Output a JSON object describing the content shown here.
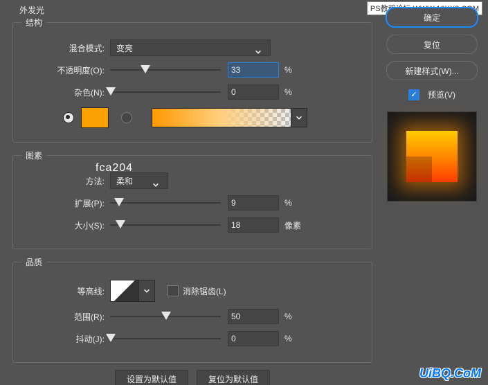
{
  "title": "外发光",
  "structure": {
    "legend": "结构",
    "blend_label": "混合模式:",
    "blend_value": "变亮",
    "opacity_label": "不透明度(O):",
    "opacity_value": "33",
    "opacity_unit": "%",
    "noise_label": "杂色(N):",
    "noise_value": "0",
    "noise_unit": "%",
    "color_hex": "fca204",
    "swatch_color": "#fca204"
  },
  "elements": {
    "legend": "图素",
    "technique_label": "方法:",
    "technique_value": "柔和",
    "spread_label": "扩展(P):",
    "spread_value": "9",
    "spread_unit": "%",
    "size_label": "大小(S):",
    "size_value": "18",
    "size_unit": "像素"
  },
  "quality": {
    "legend": "品质",
    "contour_label": "等高线:",
    "antialias_label": "消除锯齿(L)",
    "range_label": "范围(R):",
    "range_value": "50",
    "range_unit": "%",
    "jitter_label": "抖动(J):",
    "jitter_value": "0",
    "jitter_unit": "%"
  },
  "bottom": {
    "default_btn": "设置为默认值",
    "reset_btn": "复位为默认值"
  },
  "side": {
    "ok": "确定",
    "reset": "复位",
    "new_style": "新建样式(W)...",
    "preview_label": "预览(V)"
  },
  "watermark": {
    "top": "PS教程论坛 WWW.16XX8.COM",
    "bottom": "UiBQ.CoM"
  }
}
